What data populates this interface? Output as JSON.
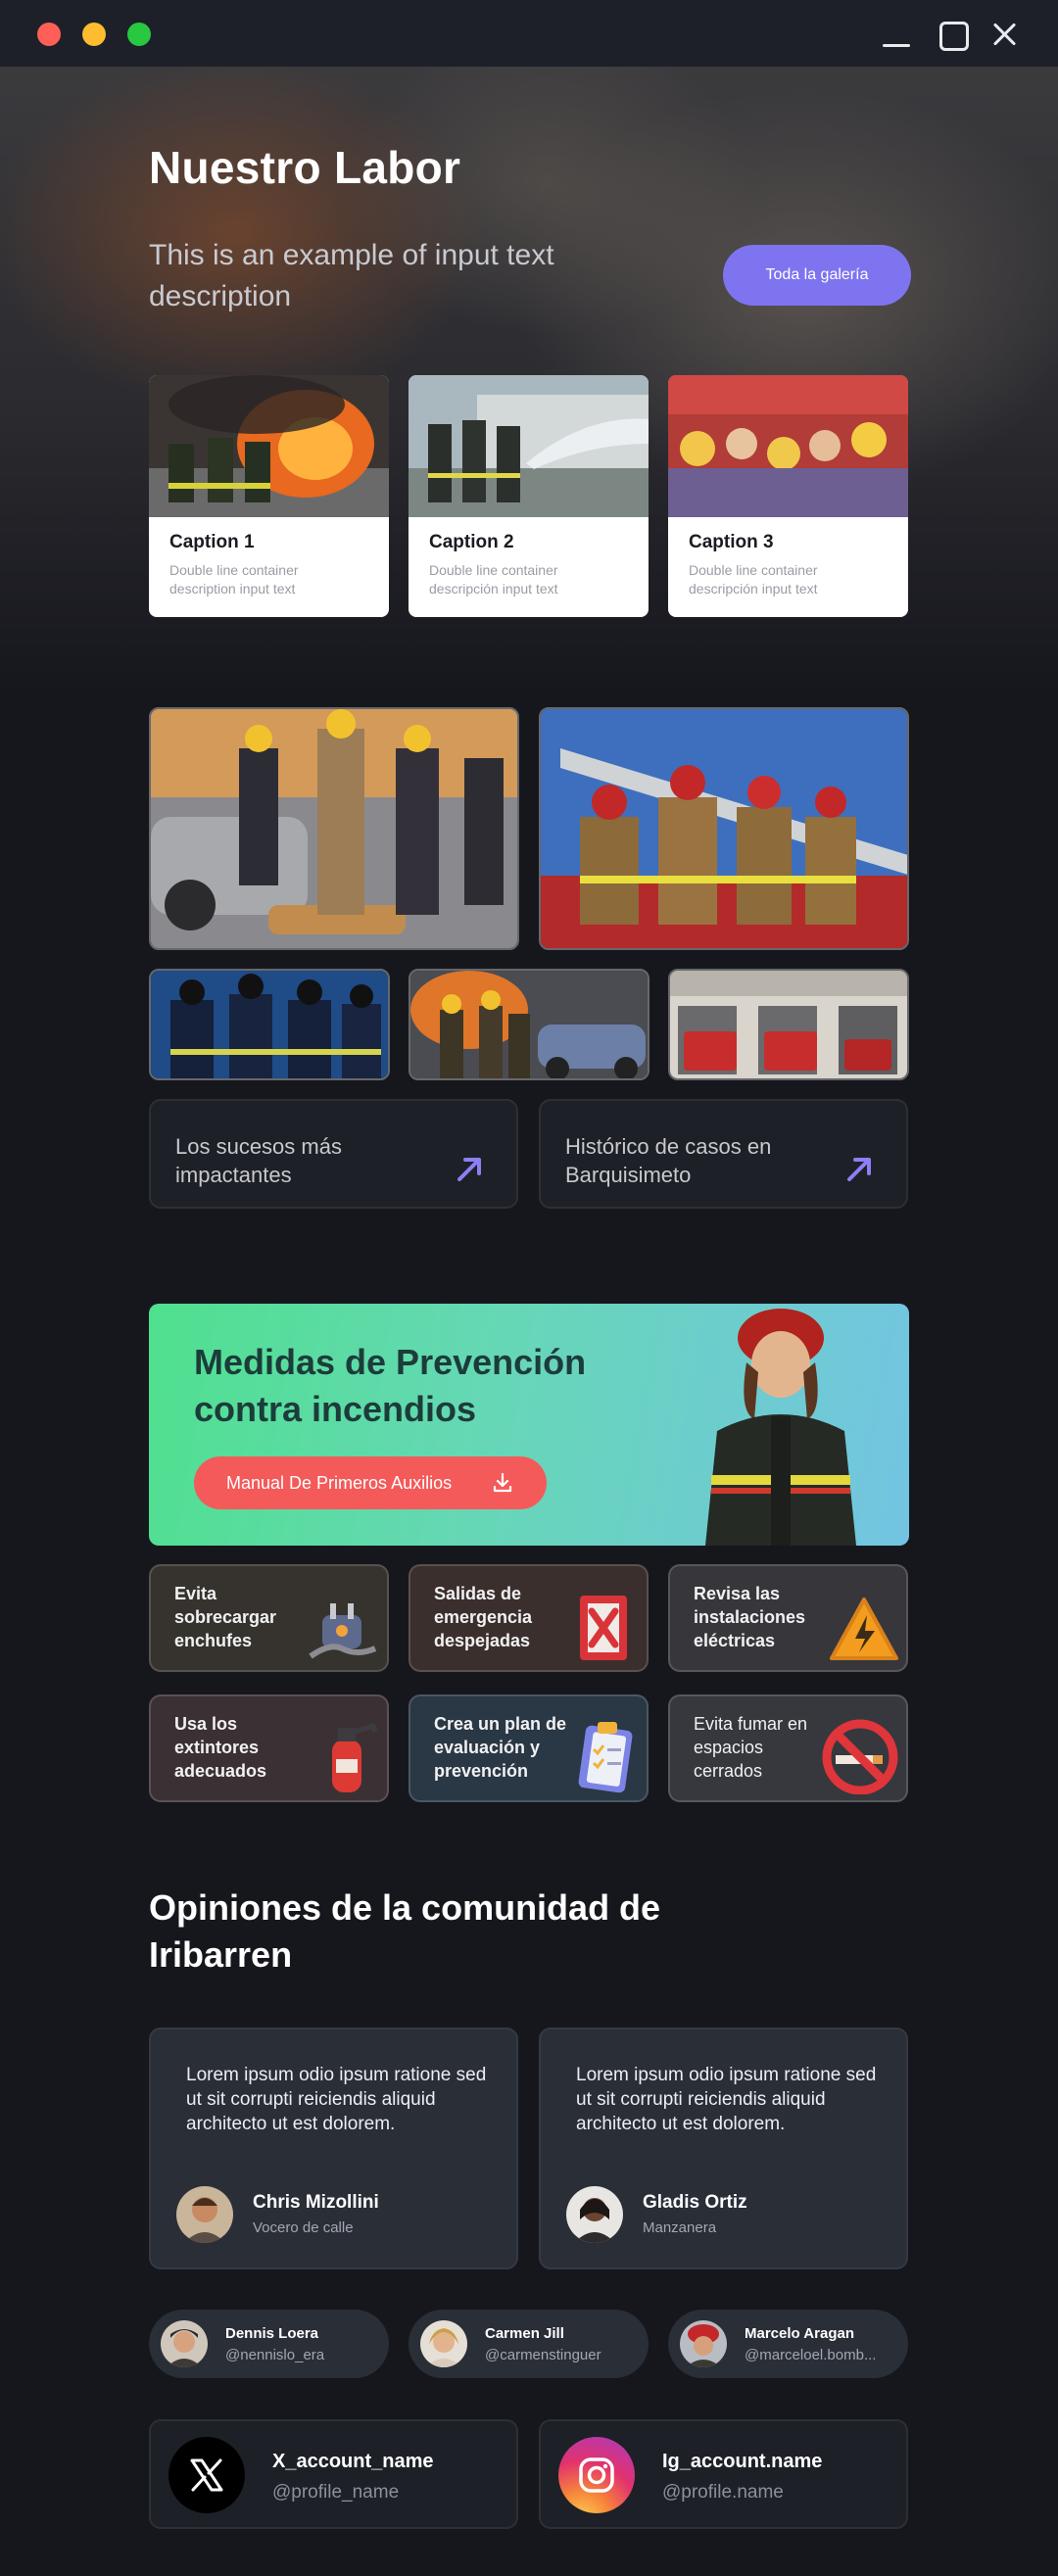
{
  "hero": {
    "title": "Nuestro Labor",
    "description": "This is an example of input text description",
    "gallery_button": "Toda la galería"
  },
  "captions": [
    {
      "title": "Caption 1",
      "desc": "Double line container description input text"
    },
    {
      "title": "Caption 2",
      "desc": "Double line container descripción input text"
    },
    {
      "title": "Caption 3",
      "desc": "Double line container descripción input text"
    }
  ],
  "links": [
    {
      "label": "Los sucesos más impactantes"
    },
    {
      "label": "Histórico de casos en Barquisimeto"
    }
  ],
  "prevention": {
    "title": "Medidas de Prevención contra incendios",
    "button": "Manual De Primeros Auxilios"
  },
  "tips": [
    {
      "label": "Evita sobrecargar enchufes",
      "icon": "plug-icon"
    },
    {
      "label": "Salidas de emergencia despejadas",
      "icon": "emergency-exit-icon"
    },
    {
      "label": "Revisa las instalaciones eléctricas",
      "icon": "high-voltage-icon"
    },
    {
      "label": "Usa los extintores adecuados",
      "icon": "fire-extinguisher-icon"
    },
    {
      "label": "Crea un plan de evaluación y prevención",
      "icon": "checklist-icon"
    },
    {
      "label": "Evita fumar en espacios cerrados",
      "icon": "no-smoking-icon"
    }
  ],
  "community": {
    "title": "Opiniones de la comunidad de Iribarren"
  },
  "testimonials": [
    {
      "quote": "Lorem ipsum odio ipsum ratione sed ut sit corrupti reiciendis aliquid architecto ut est dolorem.",
      "name": "Chris Mizollini",
      "role": "Vocero de calle"
    },
    {
      "quote": "Lorem ipsum odio ipsum ratione sed ut sit corrupti reiciendis aliquid architecto ut est dolorem.",
      "name": "Gladis Ortiz",
      "role": "Manzanera"
    }
  ],
  "users": [
    {
      "name": "Dennis Loera",
      "handle": "@nennislo_era"
    },
    {
      "name": "Carmen Jill",
      "handle": "@carmenstinguer"
    },
    {
      "name": "Marcelo Aragan",
      "handle": "@marceloel.bomb..."
    }
  ],
  "socials": [
    {
      "name": "X_account_name",
      "handle": "@profile_name",
      "icon": "x-logo-icon"
    },
    {
      "name": "Ig_account.name",
      "handle": "@profile.name",
      "icon": "instagram-logo-icon"
    }
  ],
  "colors": {
    "accent": "#7f74f0",
    "danger_button": "#f45a5a",
    "background": "#16171d"
  }
}
